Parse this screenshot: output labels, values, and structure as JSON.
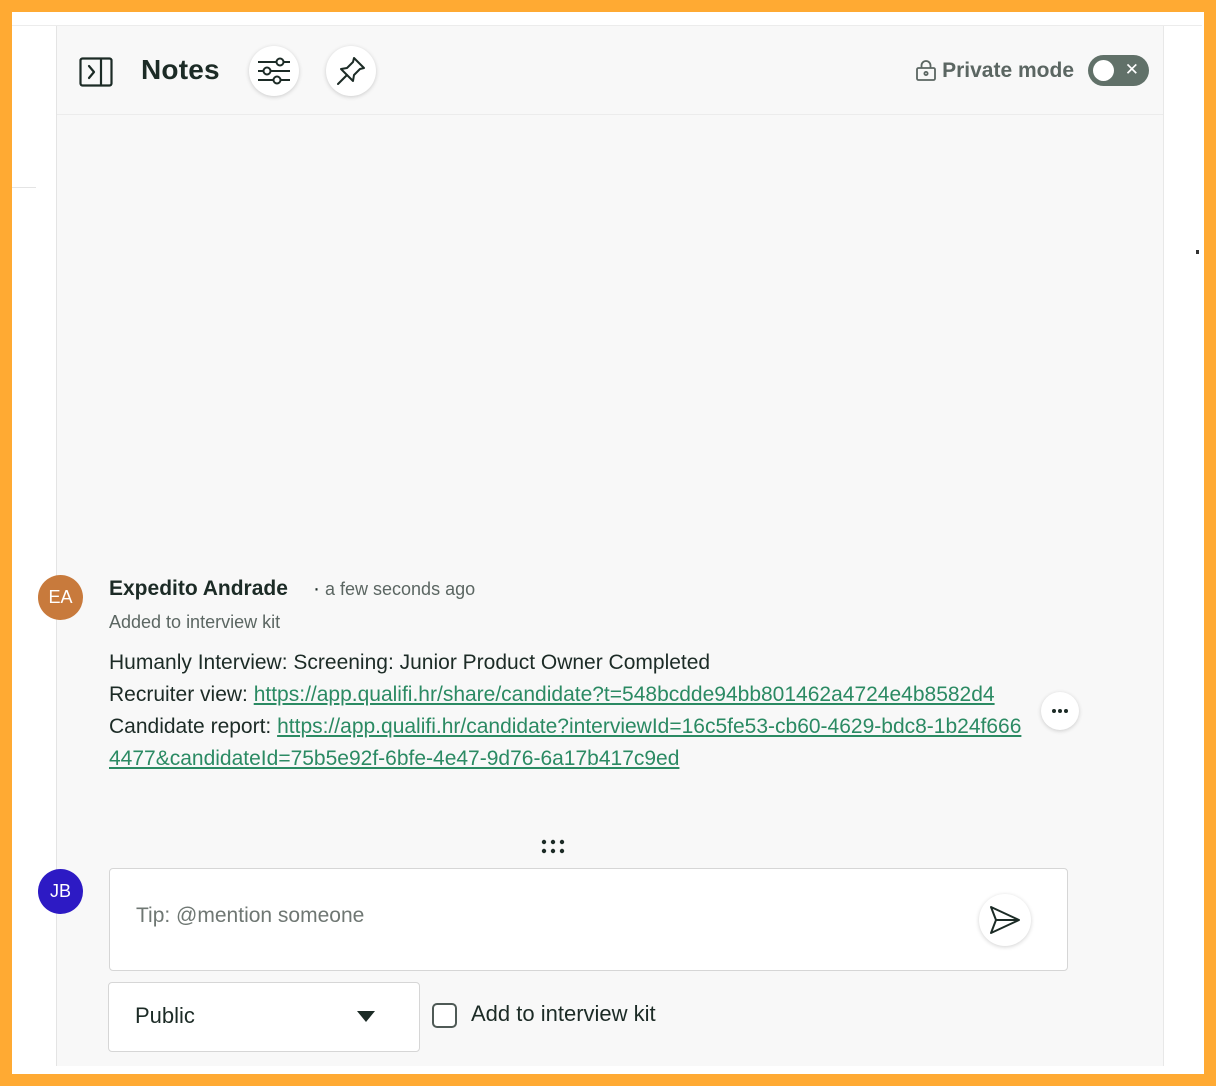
{
  "header": {
    "title": "Notes",
    "private_mode_label": "Private mode",
    "private_mode_enabled": false,
    "icons": [
      "sidebar-collapse-icon",
      "filter-sliders-icon",
      "pin-icon",
      "lock-icon"
    ]
  },
  "note": {
    "avatar_initials": "EA",
    "author": "Expedito Andrade",
    "separator": "·",
    "time": "a few seconds ago",
    "added_label": "Added to interview kit",
    "line1": "Humanly Interview: Screening: Junior Product Owner Completed",
    "recruiter_label": "Recruiter view: ",
    "recruiter_link": "https://app.qualifi.hr/share/candidate?t=548bcdde94bb801462a4724e4b8582d4",
    "candidate_label": "Candidate report: ",
    "candidate_link": "https://app.qualifi.hr/candidate?interviewId=16c5fe53-cb60-4629-bdc8-1b24f6664477&candidateId=75b5e92f-6bfe-4e47-9d76-6a17b417c9ed",
    "avatar_color": "#c87a3c",
    "link_color": "#2b8a63"
  },
  "composer": {
    "avatar_initials": "JB",
    "avatar_color": "#2d1ac4",
    "placeholder": "Tip: @mention someone",
    "visibility_value": "Public",
    "add_to_kit_label": "Add to interview kit",
    "add_to_kit_checked": false
  }
}
